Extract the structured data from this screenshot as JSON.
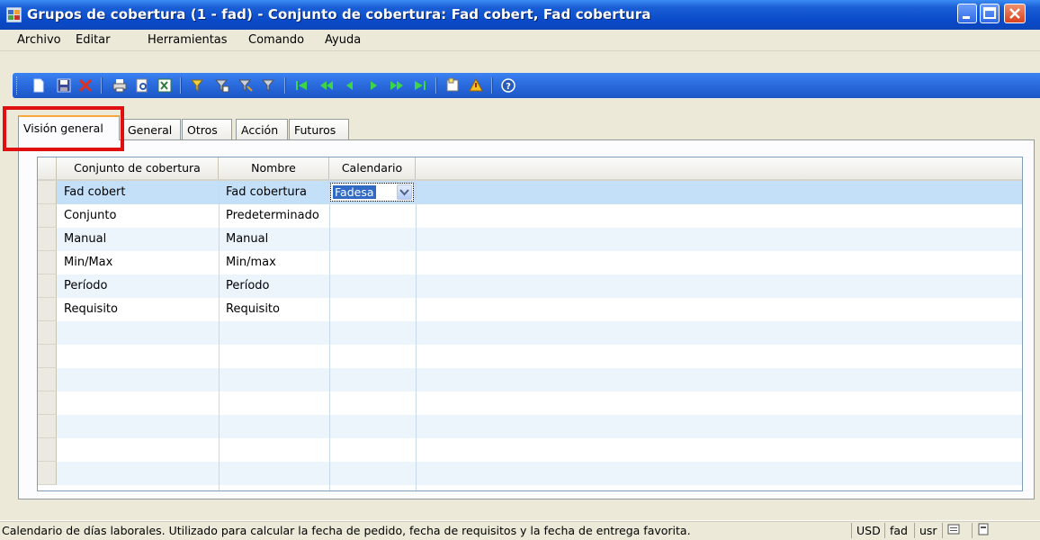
{
  "window": {
    "title": "Grupos de cobertura (1 - fad) - Conjunto de cobertura: Fad cobert, Fad cobertura"
  },
  "menu": [
    "Archivo",
    "Editar",
    "Herramientas",
    "Comando",
    "Ayuda"
  ],
  "toolbar": {
    "icons": [
      "new-icon",
      "save-icon",
      "delete-icon",
      "print-icon",
      "print-preview-icon",
      "export-excel-icon",
      "filter-by-selection-icon",
      "filter-by-grid-icon",
      "advanced-filter-icon",
      "remove-filter-icon",
      "first-record-icon",
      "previous-page-icon",
      "previous-record-icon",
      "next-record-icon",
      "next-page-icon",
      "last-record-icon",
      "document-handling-icon",
      "alert-icon",
      "help-icon"
    ]
  },
  "tabs": [
    "Visión general",
    "General",
    "Otros",
    "Acción",
    "Futuros"
  ],
  "grid": {
    "columns": [
      "Conjunto de cobertura",
      "Nombre",
      "Calendario"
    ],
    "rows": [
      {
        "set": "Fad cobert",
        "name": "Fad cobertura",
        "calendar": "Fadesa"
      },
      {
        "set": "Conjunto",
        "name": "Predeterminado",
        "calendar": ""
      },
      {
        "set": "Manual",
        "name": "Manual",
        "calendar": ""
      },
      {
        "set": "Min/Max",
        "name": "Min/max",
        "calendar": ""
      },
      {
        "set": "Período",
        "name": "Período",
        "calendar": ""
      },
      {
        "set": "Requisito",
        "name": "Requisito",
        "calendar": ""
      }
    ]
  },
  "status": {
    "message": "Calendario de días laborales. Utilizado para calcular la fecha de pedido, fecha de requisitos y la fecha de entrega favorita.",
    "currency": "USD",
    "company": "fad",
    "user": "usr"
  },
  "colors": {
    "title_bar": "#0a4ac9",
    "toolbar": "#2c6ee0",
    "selected_row": "#c4e0f8",
    "highlight_box": "#e01010",
    "active_tab_accent": "#f6a83d"
  }
}
